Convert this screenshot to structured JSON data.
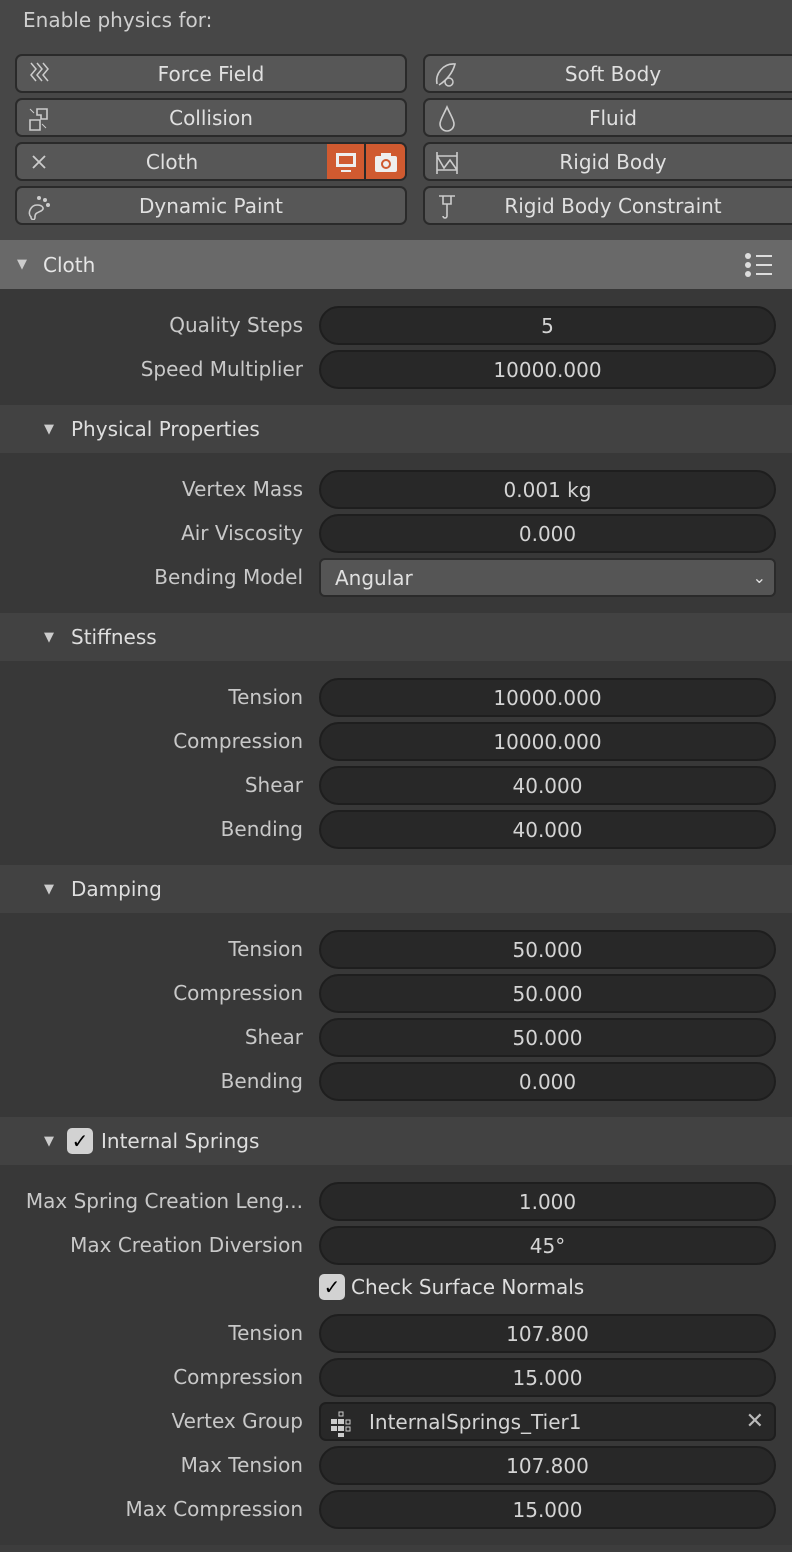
{
  "physics": {
    "title": "Enable physics for:",
    "buttons": [
      {
        "label": "Force Field",
        "icon": "force-field-icon",
        "side": "l"
      },
      {
        "label": "Soft Body",
        "icon": "soft-body-icon",
        "side": "r"
      },
      {
        "label": "Collision",
        "icon": "collision-icon",
        "side": "l"
      },
      {
        "label": "Fluid",
        "icon": "fluid-icon",
        "side": "r"
      },
      {
        "label": "Cloth",
        "icon": "x-remove-icon",
        "side": "l",
        "enabled": true
      },
      {
        "label": "Rigid Body",
        "icon": "rigid-body-icon",
        "side": "r"
      },
      {
        "label": "Dynamic Paint",
        "icon": "dynamic-paint-icon",
        "side": "l"
      },
      {
        "label": "Rigid Body Constraint",
        "icon": "rigid-body-constraint-icon",
        "side": "r"
      }
    ],
    "accent": "#d05a30"
  },
  "cloth": {
    "title": "Cloth",
    "rows": [
      {
        "label": "Quality Steps",
        "value": "5"
      },
      {
        "label": "Speed Multiplier",
        "value": "10000.000"
      }
    ]
  },
  "sections": [
    {
      "title": "Physical Properties",
      "rows": [
        {
          "label": "Vertex Mass",
          "value": "0.001 kg"
        },
        {
          "label": "Air Viscosity",
          "value": "0.000"
        },
        {
          "label": "Bending Model",
          "value": "Angular",
          "type": "select"
        }
      ]
    },
    {
      "title": "Stiffness",
      "rows": [
        {
          "label": "Tension",
          "value": "10000.000"
        },
        {
          "label": "Compression",
          "value": "10000.000"
        },
        {
          "label": "Shear",
          "value": "40.000"
        },
        {
          "label": "Bending",
          "value": "40.000"
        }
      ]
    },
    {
      "title": "Damping",
      "rows": [
        {
          "label": "Tension",
          "value": "50.000"
        },
        {
          "label": "Compression",
          "value": "50.000"
        },
        {
          "label": "Shear",
          "value": "50.000"
        },
        {
          "label": "Bending",
          "value": "0.000"
        }
      ]
    },
    {
      "title": "Internal Springs",
      "checked": true,
      "rows": [
        {
          "label": "Max Spring Creation Leng...",
          "value": "1.000"
        },
        {
          "label": "Max Creation Diversion",
          "value": "45°"
        },
        {
          "label": "",
          "value": "Check Surface Normals",
          "type": "checkbox",
          "checked": true
        },
        {
          "label": "Tension",
          "value": "107.800"
        },
        {
          "label": "Compression",
          "value": "15.000"
        },
        {
          "label": "Vertex Group",
          "value": "InternalSprings_Tier1",
          "type": "vgroup"
        },
        {
          "label": "Max Tension",
          "value": "107.800"
        },
        {
          "label": "Max Compression",
          "value": "15.000"
        }
      ]
    }
  ]
}
